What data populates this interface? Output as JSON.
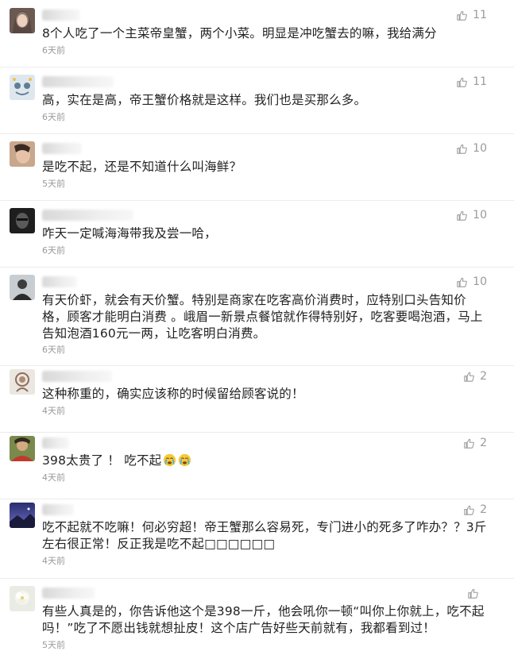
{
  "comments": [
    {
      "text": "8个人吃了一个主菜帝皇蟹，两个小菜。明显是冲吃蟹去的嘛，我给满分",
      "time": "6天前",
      "likes": "11",
      "avatar": "avatar-1"
    },
    {
      "text": "高，实在是高，帝王蟹价格就是这样。我们也是买那么多。",
      "time": "6天前",
      "likes": "11",
      "avatar": "avatar-2"
    },
    {
      "text": "是吃不起，还是不知道什么叫海鲜？",
      "time": "5天前",
      "likes": "10",
      "avatar": "avatar-3"
    },
    {
      "text": "咋天一定喊海海带我及尝一哈，",
      "time": "6天前",
      "likes": "10",
      "avatar": "avatar-4"
    },
    {
      "text": "有天价虾，就会有天价蟹。特别是商家在吃客高价消费时，应特别口头告知价格，顾客才能明白消费 。峨眉一新景点餐馆就作得特别好，吃客要喝泡酒，马上告知泡酒160元一两，让吃客明白消费。",
      "time": "6天前",
      "likes": "10",
      "avatar": "avatar-5"
    },
    {
      "text": "这种称重的，确实应该称的时候留给顾客说的！",
      "time": "4天前",
      "likes": "2",
      "avatar": "avatar-6"
    },
    {
      "text": "398太贵了 ！ 吃不起",
      "time": "4天前",
      "likes": "2",
      "avatar": "avatar-7",
      "emoji_count": 2
    },
    {
      "text": "吃不起就不吃嘛！何必穷超！帝王蟹那么容易死，专门进小的死多了咋办？？3斤左右很正常！反正我是吃不起□□□□□□",
      "time": "4天前",
      "likes": "2",
      "avatar": "avatar-8"
    },
    {
      "text": "有些人真是的，你告诉他这个是398一斤，他会吼你一顿“叫你上你就上，吃不起吗！”吃了不愿出钱就想扯皮！这个店广告好些天前就有，我都看到过！",
      "time": "5天前",
      "likes": "",
      "avatar": "avatar-9"
    }
  ],
  "colors": {
    "text": "#222222",
    "meta": "#999999",
    "like": "#9a9a9a",
    "divider": "#ececec"
  },
  "icons": {
    "like": "thumbs-up-icon",
    "emoji": "crying-face-icon"
  }
}
